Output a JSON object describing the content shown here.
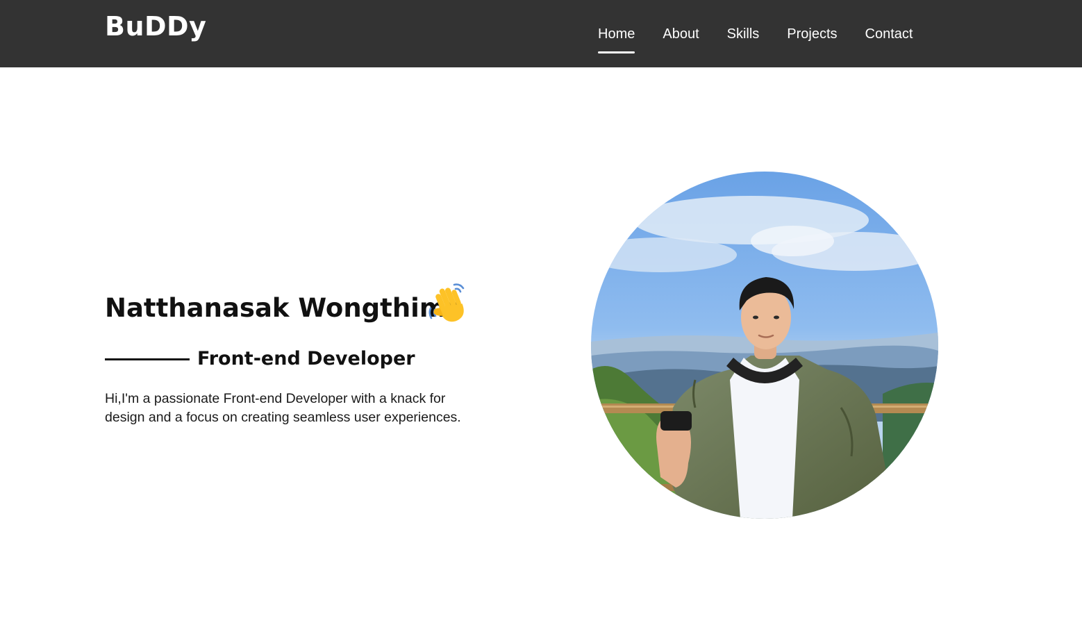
{
  "header": {
    "brand": "BuDDy",
    "nav": [
      {
        "label": "Home",
        "active": true
      },
      {
        "label": "About",
        "active": false
      },
      {
        "label": "Skills",
        "active": false
      },
      {
        "label": "Projects",
        "active": false
      },
      {
        "label": "Contact",
        "active": false
      }
    ]
  },
  "hero": {
    "name": "Natthanasak Wongthima",
    "wave_icon": "waving-hand-icon",
    "role": "Front-end Developer",
    "description": "Hi,I'm a passionate Front-end Developer with a knack for design and a focus on creating seamless user experiences.",
    "portrait": "profile-photo"
  },
  "colors": {
    "navbar_bg": "#333333",
    "nav_text": "#ffffff",
    "page_bg": "#ffffff",
    "text": "#111111"
  }
}
